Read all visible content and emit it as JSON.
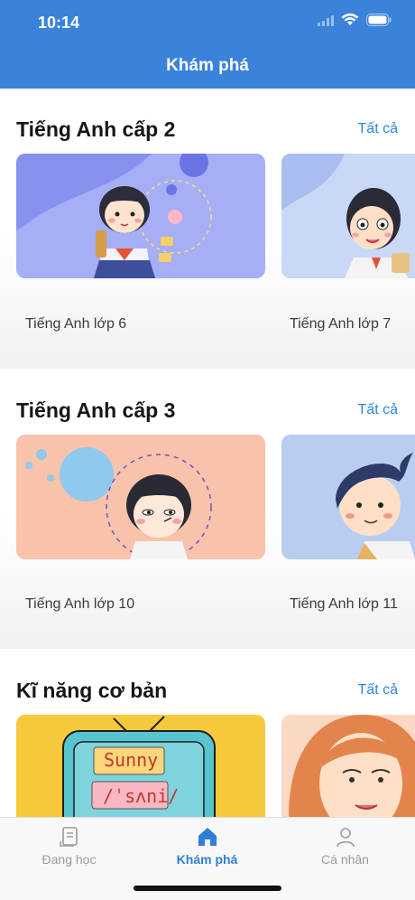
{
  "status_bar": {
    "time": "10:14"
  },
  "header": {
    "title": "Khám phá"
  },
  "sections": [
    {
      "title": "Tiếng Anh cấp 2",
      "see_all": "Tất cả",
      "cards": [
        {
          "label": "Tiếng Anh lớp 6",
          "bg": "#a6aef5"
        },
        {
          "label": "Tiếng Anh lớp 7",
          "bg": "#c9d8f7"
        }
      ]
    },
    {
      "title": "Tiếng Anh cấp 3",
      "see_all": "Tất cả",
      "cards": [
        {
          "label": "Tiếng Anh lớp 10",
          "bg": "#f8c3aa"
        },
        {
          "label": "Tiếng Anh lớp 11",
          "bg": "#b9cdf0"
        }
      ]
    },
    {
      "title": "Kĩ năng cơ bản",
      "see_all": "Tất cả",
      "cards": [
        {
          "label": "",
          "bg": "#f7c93a",
          "tv_text_1": "Sunny",
          "tv_text_2": "/ˈsʌni/"
        },
        {
          "label": "",
          "bg": "#f9d8c4"
        }
      ]
    }
  ],
  "tabbar": {
    "tabs": [
      {
        "label": "Đang học",
        "icon": "book-icon",
        "active": false
      },
      {
        "label": "Khám phá",
        "icon": "home-icon",
        "active": true
      },
      {
        "label": "Cá nhân",
        "icon": "person-icon",
        "active": false
      }
    ]
  },
  "colors": {
    "header": "#3b82db",
    "accent": "#2c86d8",
    "active_tab": "#2f7fd6"
  }
}
